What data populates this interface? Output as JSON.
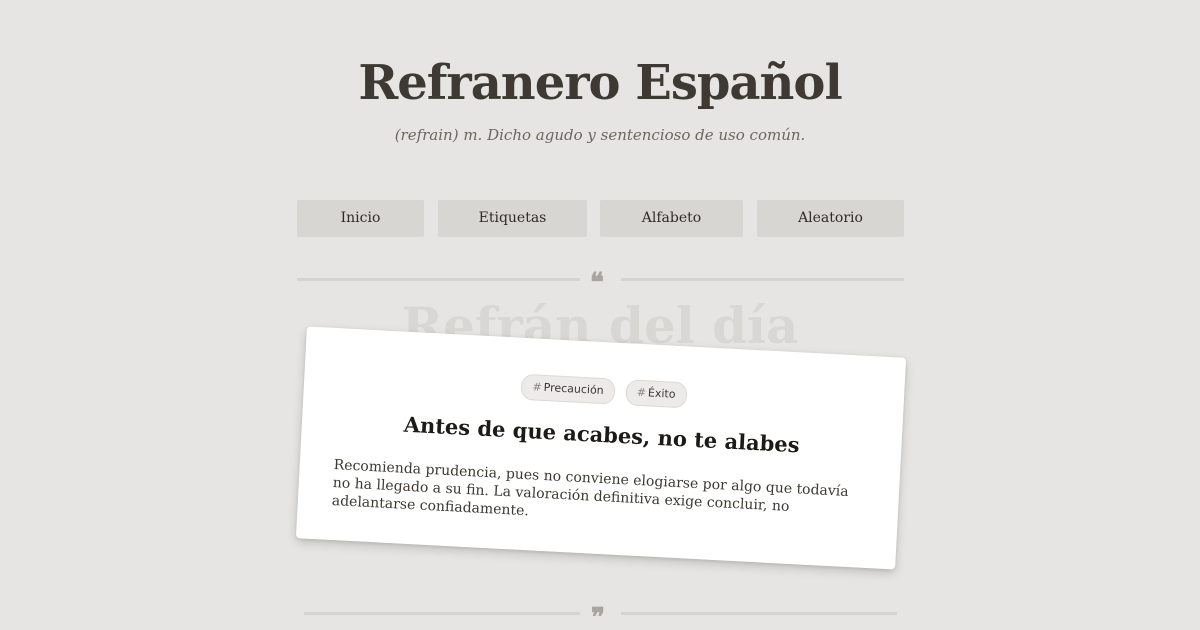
{
  "header": {
    "title": "Refranero Español",
    "subtitle": "(refrain) m. Dicho agudo y sentencioso de uso común."
  },
  "nav": {
    "items": [
      {
        "label": "Inicio"
      },
      {
        "label": "Etiquetas"
      },
      {
        "label": "Alfabeto"
      },
      {
        "label": "Aleatorio"
      }
    ]
  },
  "section": {
    "heading": "Refrán del día",
    "open_quote": "❝",
    "close_quote": "❞"
  },
  "proverb": {
    "tags": [
      {
        "hash": "#",
        "label": "Precaución"
      },
      {
        "hash": "#",
        "label": "Éxito"
      }
    ],
    "title": "Antes de que acabes, no te alabes",
    "description": "Recomienda prudencia, pues no conviene elogiarse por algo que todavía no ha llegado a su fin. La valoración definitiva exige concluir, no adelantarse confiadamente."
  },
  "colors": {
    "background": "#e6e5e3",
    "nav_button": "#d8d6d3",
    "card": "#ffffff",
    "title": "#3e3a33"
  }
}
